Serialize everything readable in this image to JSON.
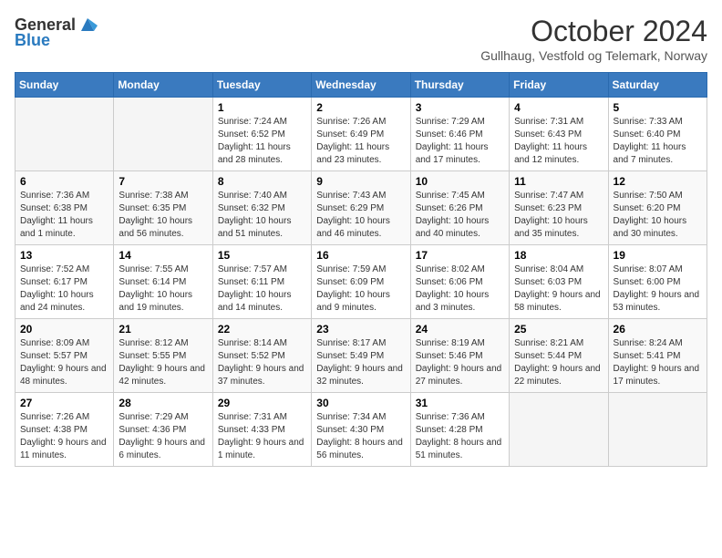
{
  "header": {
    "logo_general": "General",
    "logo_blue": "Blue",
    "month_title": "October 2024",
    "location": "Gullhaug, Vestfold og Telemark, Norway"
  },
  "days_of_week": [
    "Sunday",
    "Monday",
    "Tuesday",
    "Wednesday",
    "Thursday",
    "Friday",
    "Saturday"
  ],
  "weeks": [
    [
      {
        "day": "",
        "sunrise": "",
        "sunset": "",
        "daylight": "",
        "empty": true
      },
      {
        "day": "",
        "sunrise": "",
        "sunset": "",
        "daylight": "",
        "empty": true
      },
      {
        "day": "1",
        "sunrise": "Sunrise: 7:24 AM",
        "sunset": "Sunset: 6:52 PM",
        "daylight": "Daylight: 11 hours and 28 minutes."
      },
      {
        "day": "2",
        "sunrise": "Sunrise: 7:26 AM",
        "sunset": "Sunset: 6:49 PM",
        "daylight": "Daylight: 11 hours and 23 minutes."
      },
      {
        "day": "3",
        "sunrise": "Sunrise: 7:29 AM",
        "sunset": "Sunset: 6:46 PM",
        "daylight": "Daylight: 11 hours and 17 minutes."
      },
      {
        "day": "4",
        "sunrise": "Sunrise: 7:31 AM",
        "sunset": "Sunset: 6:43 PM",
        "daylight": "Daylight: 11 hours and 12 minutes."
      },
      {
        "day": "5",
        "sunrise": "Sunrise: 7:33 AM",
        "sunset": "Sunset: 6:40 PM",
        "daylight": "Daylight: 11 hours and 7 minutes."
      }
    ],
    [
      {
        "day": "6",
        "sunrise": "Sunrise: 7:36 AM",
        "sunset": "Sunset: 6:38 PM",
        "daylight": "Daylight: 11 hours and 1 minute."
      },
      {
        "day": "7",
        "sunrise": "Sunrise: 7:38 AM",
        "sunset": "Sunset: 6:35 PM",
        "daylight": "Daylight: 10 hours and 56 minutes."
      },
      {
        "day": "8",
        "sunrise": "Sunrise: 7:40 AM",
        "sunset": "Sunset: 6:32 PM",
        "daylight": "Daylight: 10 hours and 51 minutes."
      },
      {
        "day": "9",
        "sunrise": "Sunrise: 7:43 AM",
        "sunset": "Sunset: 6:29 PM",
        "daylight": "Daylight: 10 hours and 46 minutes."
      },
      {
        "day": "10",
        "sunrise": "Sunrise: 7:45 AM",
        "sunset": "Sunset: 6:26 PM",
        "daylight": "Daylight: 10 hours and 40 minutes."
      },
      {
        "day": "11",
        "sunrise": "Sunrise: 7:47 AM",
        "sunset": "Sunset: 6:23 PM",
        "daylight": "Daylight: 10 hours and 35 minutes."
      },
      {
        "day": "12",
        "sunrise": "Sunrise: 7:50 AM",
        "sunset": "Sunset: 6:20 PM",
        "daylight": "Daylight: 10 hours and 30 minutes."
      }
    ],
    [
      {
        "day": "13",
        "sunrise": "Sunrise: 7:52 AM",
        "sunset": "Sunset: 6:17 PM",
        "daylight": "Daylight: 10 hours and 24 minutes."
      },
      {
        "day": "14",
        "sunrise": "Sunrise: 7:55 AM",
        "sunset": "Sunset: 6:14 PM",
        "daylight": "Daylight: 10 hours and 19 minutes."
      },
      {
        "day": "15",
        "sunrise": "Sunrise: 7:57 AM",
        "sunset": "Sunset: 6:11 PM",
        "daylight": "Daylight: 10 hours and 14 minutes."
      },
      {
        "day": "16",
        "sunrise": "Sunrise: 7:59 AM",
        "sunset": "Sunset: 6:09 PM",
        "daylight": "Daylight: 10 hours and 9 minutes."
      },
      {
        "day": "17",
        "sunrise": "Sunrise: 8:02 AM",
        "sunset": "Sunset: 6:06 PM",
        "daylight": "Daylight: 10 hours and 3 minutes."
      },
      {
        "day": "18",
        "sunrise": "Sunrise: 8:04 AM",
        "sunset": "Sunset: 6:03 PM",
        "daylight": "Daylight: 9 hours and 58 minutes."
      },
      {
        "day": "19",
        "sunrise": "Sunrise: 8:07 AM",
        "sunset": "Sunset: 6:00 PM",
        "daylight": "Daylight: 9 hours and 53 minutes."
      }
    ],
    [
      {
        "day": "20",
        "sunrise": "Sunrise: 8:09 AM",
        "sunset": "Sunset: 5:57 PM",
        "daylight": "Daylight: 9 hours and 48 minutes."
      },
      {
        "day": "21",
        "sunrise": "Sunrise: 8:12 AM",
        "sunset": "Sunset: 5:55 PM",
        "daylight": "Daylight: 9 hours and 42 minutes."
      },
      {
        "day": "22",
        "sunrise": "Sunrise: 8:14 AM",
        "sunset": "Sunset: 5:52 PM",
        "daylight": "Daylight: 9 hours and 37 minutes."
      },
      {
        "day": "23",
        "sunrise": "Sunrise: 8:17 AM",
        "sunset": "Sunset: 5:49 PM",
        "daylight": "Daylight: 9 hours and 32 minutes."
      },
      {
        "day": "24",
        "sunrise": "Sunrise: 8:19 AM",
        "sunset": "Sunset: 5:46 PM",
        "daylight": "Daylight: 9 hours and 27 minutes."
      },
      {
        "day": "25",
        "sunrise": "Sunrise: 8:21 AM",
        "sunset": "Sunset: 5:44 PM",
        "daylight": "Daylight: 9 hours and 22 minutes."
      },
      {
        "day": "26",
        "sunrise": "Sunrise: 8:24 AM",
        "sunset": "Sunset: 5:41 PM",
        "daylight": "Daylight: 9 hours and 17 minutes."
      }
    ],
    [
      {
        "day": "27",
        "sunrise": "Sunrise: 7:26 AM",
        "sunset": "Sunset: 4:38 PM",
        "daylight": "Daylight: 9 hours and 11 minutes."
      },
      {
        "day": "28",
        "sunrise": "Sunrise: 7:29 AM",
        "sunset": "Sunset: 4:36 PM",
        "daylight": "Daylight: 9 hours and 6 minutes."
      },
      {
        "day": "29",
        "sunrise": "Sunrise: 7:31 AM",
        "sunset": "Sunset: 4:33 PM",
        "daylight": "Daylight: 9 hours and 1 minute."
      },
      {
        "day": "30",
        "sunrise": "Sunrise: 7:34 AM",
        "sunset": "Sunset: 4:30 PM",
        "daylight": "Daylight: 8 hours and 56 minutes."
      },
      {
        "day": "31",
        "sunrise": "Sunrise: 7:36 AM",
        "sunset": "Sunset: 4:28 PM",
        "daylight": "Daylight: 8 hours and 51 minutes."
      },
      {
        "day": "",
        "sunrise": "",
        "sunset": "",
        "daylight": "",
        "empty": true
      },
      {
        "day": "",
        "sunrise": "",
        "sunset": "",
        "daylight": "",
        "empty": true
      }
    ]
  ]
}
